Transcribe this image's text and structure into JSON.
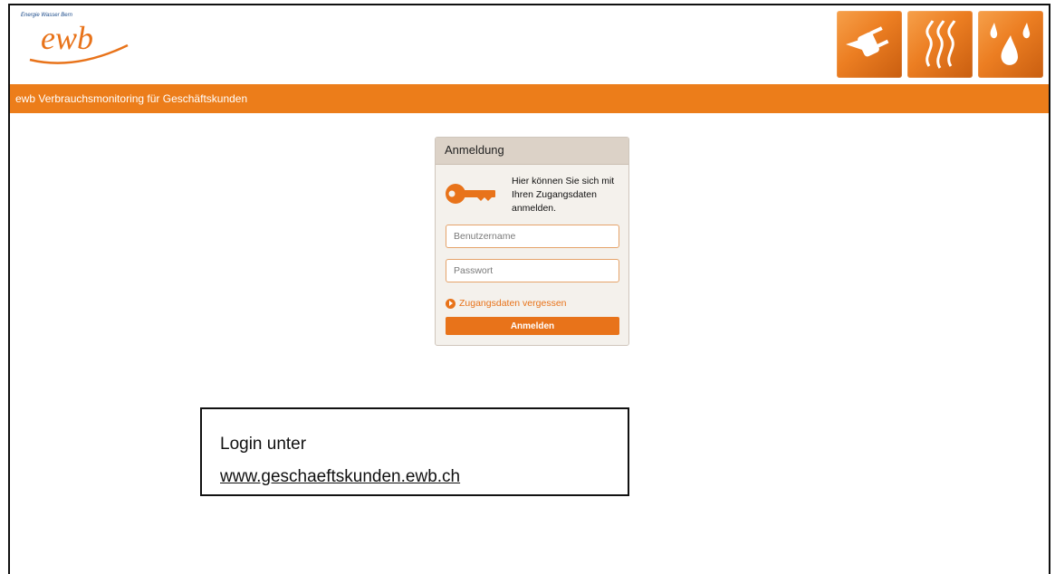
{
  "header": {
    "logo_tagline": "Energie Wasser Bern",
    "logo_text": "ewb",
    "utility_icons": [
      "plug-icon",
      "heat-icon",
      "water-drops-icon"
    ]
  },
  "banner": {
    "title": "ewb Verbrauchsmonitoring für Geschäftskunden"
  },
  "login": {
    "heading": "Anmeldung",
    "intro": "Hier können Sie sich mit Ihren Zugangsdaten anmelden.",
    "username_placeholder": "Benutzername",
    "username_value": "",
    "password_placeholder": "Passwort",
    "password_value": "",
    "forgot_link": "Zugangsdaten vergessen",
    "submit_label": "Anmelden"
  },
  "note": {
    "line1": "Login unter",
    "line2": "www.geschaeftskunden.ewb.ch"
  },
  "colors": {
    "accent": "#ec7d1a",
    "panel_bg": "#f4f1ec",
    "panel_header": "#dcd2c7"
  }
}
